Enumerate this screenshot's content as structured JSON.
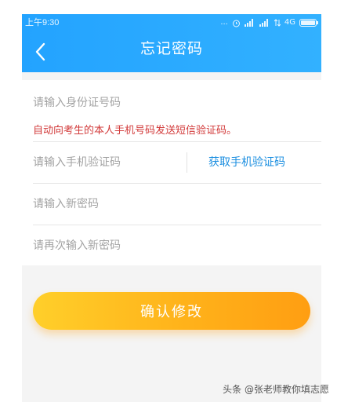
{
  "status_bar": {
    "time": "上午9:30",
    "dots": "...",
    "network": "4G"
  },
  "nav": {
    "title": "忘记密码",
    "back_icon": "chevron-left-icon"
  },
  "form": {
    "id_number": {
      "placeholder": "请输入身份证号码",
      "value": ""
    },
    "hint": "自动向考生的本人手机号码发送短信验证码。",
    "sms_code": {
      "placeholder": "请输入手机验证码",
      "value": ""
    },
    "get_code_label": "获取手机验证码",
    "new_password": {
      "placeholder": "请输入新密码",
      "value": ""
    },
    "confirm_password": {
      "placeholder": "请再次输入新密码",
      "value": ""
    }
  },
  "confirm_button": {
    "label": "确认修改"
  },
  "watermark": "头条 @张老师教你填志愿",
  "colors": {
    "header": "#2ba9ff",
    "hint": "#d23a3a",
    "link": "#1c8fe0",
    "button_start": "#ffcf2a",
    "button_end": "#ff9e12"
  }
}
